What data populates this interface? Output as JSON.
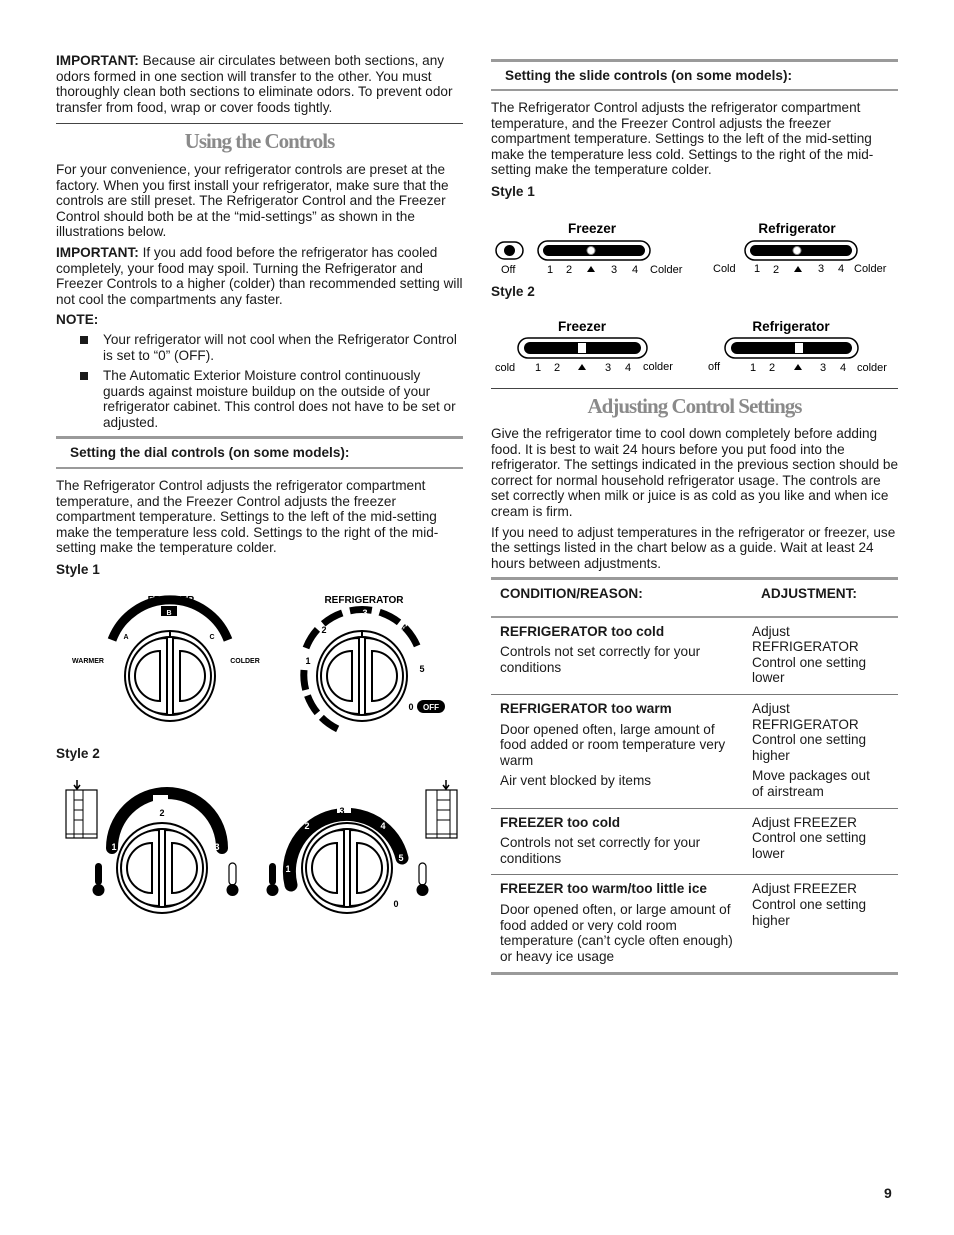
{
  "left": {
    "important1_label": "IMPORTANT:",
    "important1_text": " Because air circulates between both sections, any odors formed in one section will transfer to the other. You must thoroughly clean both sections to eliminate odors. To prevent odor transfer from food, wrap or cover foods tightly.",
    "section_title": "Using the Controls",
    "intro": "For your convenience, your refrigerator controls are preset at the factory. When you first install your refrigerator, make sure that the controls are still preset. The Refrigerator Control and the Freezer Control should both be at the “mid-settings” as shown in the illustrations below.",
    "important2_label": "IMPORTANT:",
    "important2_text": " If you add food before the refrigerator has cooled completely, your food may spoil. Turning the Refrigerator and Freezer Controls to a higher (colder) than recommended setting will not cool the compartments any faster.",
    "note_label": "NOTE:",
    "notes": [
      "Your refrigerator will not cool when the Refrigerator Control is set to “0” (OFF).",
      "The Automatic Exterior Moisture control continuously guards against moisture buildup on the outside of your refrigerator cabinet. This control does not have to be set or adjusted."
    ],
    "dial_heading": "Setting the dial controls (on some models):",
    "dial_text": "The Refrigerator Control adjusts the refrigerator compartment temperature, and the Freezer Control adjusts the freezer compartment temperature. Settings to the left of the mid-setting make the temperature less cold. Settings to the right of the mid-setting make the temperature colder.",
    "style1": "Style 1",
    "style2": "Style 2",
    "dial1": {
      "freezer": "FREEZER",
      "refrigerator": "REFRIGERATOR",
      "warmer": "WARMER",
      "colder": "COLDER",
      "a": "A",
      "b": "B",
      "c": "C",
      "r1": "1",
      "r2": "2",
      "r3": "3",
      "r4": "4",
      "r5": "5",
      "r0": "0",
      "off": "OFF"
    },
    "dial2": {
      "f1": "1",
      "f2": "2",
      "f3": "3",
      "r1": "1",
      "r2": "2",
      "r3": "3",
      "r4": "4",
      "r5": "5",
      "r0": "0"
    }
  },
  "right": {
    "slide_heading": "Setting the slide controls (on some models):",
    "slide_text": "The Refrigerator Control adjusts the refrigerator compartment temperature, and the Freezer Control adjusts the freezer compartment temperature. Settings to the left of the mid-setting make the temperature less cold. Settings to the right of the mid-setting make the temperature colder.",
    "style1": "Style 1",
    "style2": "Style 2",
    "slide1": {
      "freezer": "Freezer",
      "refrigerator": "Refrigerator",
      "off": "Off",
      "cold": "Cold",
      "n1": "1",
      "n2": "2",
      "n3": "3",
      "n4": "4",
      "colder": "Colder"
    },
    "slide2": {
      "freezer": "Freezer",
      "refrigerator": "Refrigerator",
      "cold": "cold",
      "off": "off",
      "n1": "1",
      "n2": "2",
      "n3": "3",
      "n4": "4",
      "colder": "colder"
    },
    "section_title": "Adjusting Control Settings",
    "para1": "Give the refrigerator time to cool down completely before adding food. It is best to wait 24 hours before you put food into the refrigerator. The settings indicated in the previous section should be correct for normal household refrigerator usage. The controls are set correctly when milk or juice is as cold as you like and when ice cream is firm.",
    "para2": "If you need to adjust temperatures in the refrigerator or freezer, use the settings listed in the chart below as a guide. Wait at least 24 hours between adjustments.",
    "table": {
      "headers": [
        "CONDITION/REASON:",
        "ADJUSTMENT:"
      ],
      "rows": [
        {
          "condition": "REFRIGERATOR too cold",
          "reasons": [
            "Controls not set correctly for your conditions"
          ],
          "adjustments": [
            "Adjust REFRIGERATOR Control one setting lower"
          ]
        },
        {
          "condition": "REFRIGERATOR too warm",
          "reasons": [
            "Door opened often, large amount of food added or room temperature very warm",
            "Air vent blocked by items"
          ],
          "adjustments": [
            "Adjust REFRIGERATOR Control one setting higher",
            "Move packages out of airstream"
          ]
        },
        {
          "condition": "FREEZER too cold",
          "reasons": [
            "Controls not set correctly for your conditions"
          ],
          "adjustments": [
            "Adjust FREEZER Control one setting lower"
          ]
        },
        {
          "condition": "FREEZER too warm/too little ice",
          "reasons": [
            "Door opened often, or large amount of food added or very cold room temperature (can’t cycle often enough) or heavy ice usage"
          ],
          "adjustments": [
            "Adjust FREEZER Control one setting higher"
          ]
        }
      ]
    }
  },
  "page_number": "9"
}
